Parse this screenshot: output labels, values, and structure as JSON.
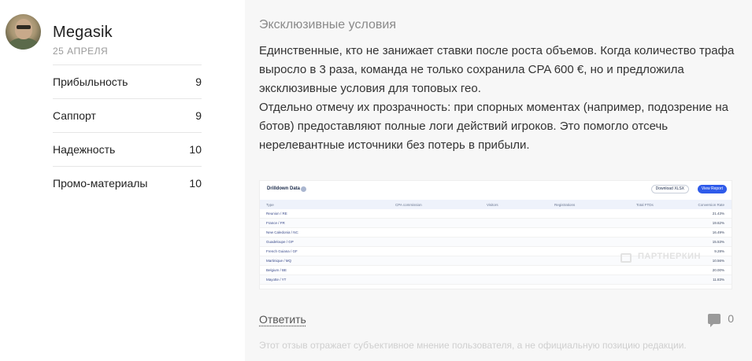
{
  "user": {
    "name": "Megasik",
    "date": "25 АПРЕЛЯ"
  },
  "ratings": [
    {
      "label": "Прибыльность",
      "value": "9"
    },
    {
      "label": "Саппорт",
      "value": "9"
    },
    {
      "label": "Надежность",
      "value": "10"
    },
    {
      "label": "Промо-материалы",
      "value": "10"
    }
  ],
  "review": {
    "title": "Эксклюзивные условия",
    "paragraph1": "Единственные, кто не занижает ставки после роста объемов. Когда количество трафа выросло в 3 раза, команда не только сохранила CPA 600 €, но и предложила эксклюзивные условия для топовых гео.",
    "paragraph2": "Отдельно отмечу их прозрачность: при спорных моментах (например, подозрение на ботов) предоставляют полные логи действий игроков. Это помогло отсечь нерелевантные источники без потерь в прибыли."
  },
  "attachment": {
    "title": "Drilldown Data",
    "download_label": "Download XLSX",
    "view_label": "View Report",
    "watermark": "ПАРТНЕРКИН",
    "columns": [
      "Type",
      "CPA commission",
      "Visitors",
      "Registrations",
      "Total FTDs",
      "Conversion Rate"
    ],
    "rows": [
      {
        "type": "Reunion / RE",
        "rate": "21.43%"
      },
      {
        "type": "France / FR",
        "rate": "19.62%"
      },
      {
        "type": "New Caledonia / NC",
        "rate": "16.49%"
      },
      {
        "type": "Guadeloupe / GP",
        "rate": "15.53%"
      },
      {
        "type": "French Guiana / GF",
        "rate": "9.28%"
      },
      {
        "type": "Martinique / MQ",
        "rate": "10.56%"
      },
      {
        "type": "Belgium / BE",
        "rate": "20.00%"
      },
      {
        "type": "Mayotte / YT",
        "rate": "11.83%"
      }
    ]
  },
  "actions": {
    "reply_label": "Ответить",
    "comment_count": "0"
  },
  "disclaimer": "Этот отзыв отражает субъективное мнение пользователя, а не официальную позицию редакции."
}
